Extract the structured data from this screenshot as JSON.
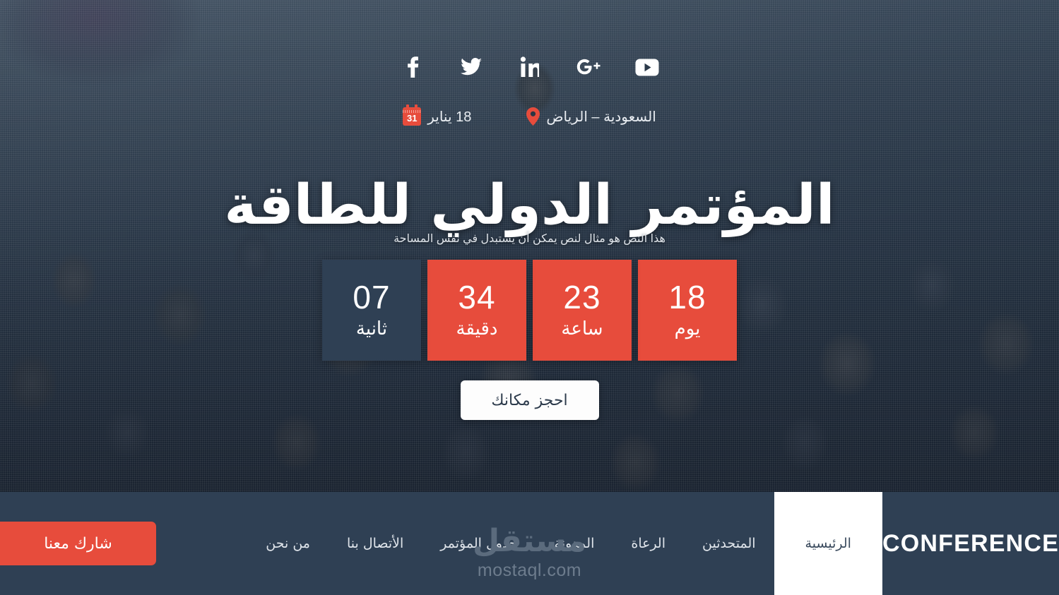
{
  "hero": {
    "social": [
      {
        "name": "facebook-icon",
        "label": "Facebook"
      },
      {
        "name": "twitter-icon",
        "label": "Twitter"
      },
      {
        "name": "linkedin-icon",
        "label": "LinkedIn"
      },
      {
        "name": "googleplus-icon",
        "label": "Google Plus"
      },
      {
        "name": "youtube-icon",
        "label": "YouTube"
      }
    ],
    "location": "السعودية – الرياض",
    "date": "18 يناير",
    "calendar_day": "31",
    "title": "المؤتمر الدولي للطاقة",
    "subtitle": "هذا النص هو مثال لنص يمكن أن يستبدل في نفس المساحة",
    "cta_label": "احجز مكانك"
  },
  "countdown": [
    {
      "value": "18",
      "unit": "يوم",
      "style": "red"
    },
    {
      "value": "23",
      "unit": "ساعة",
      "style": "red"
    },
    {
      "value": "34",
      "unit": "دقيقة",
      "style": "red"
    },
    {
      "value": "07",
      "unit": "ثانية",
      "style": "dark"
    }
  ],
  "navbar": {
    "brand": "CONFERENCE",
    "items": [
      {
        "label": "الرئيسية",
        "active": true
      },
      {
        "label": "المتحدثين",
        "active": false
      },
      {
        "label": "الرعاة",
        "active": false
      },
      {
        "label": "المدونة",
        "active": false
      },
      {
        "label": "جدول المؤتمر",
        "active": false
      },
      {
        "label": "الأتصال بنا",
        "active": false
      },
      {
        "label": "من نحن",
        "active": false
      }
    ],
    "join_label": "شارك معنا"
  },
  "watermark": {
    "logo": "مستقل",
    "url": "mostaql.com"
  },
  "colors": {
    "accent_red": "#e74c3c",
    "dark_navy": "#2f4054",
    "nav_text": "#dfe4ea",
    "white": "#ffffff"
  }
}
